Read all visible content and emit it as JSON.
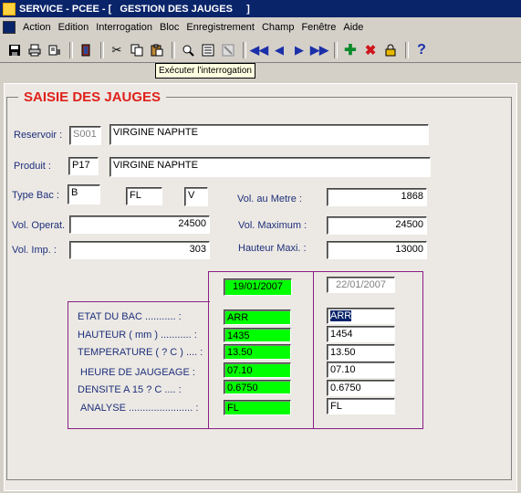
{
  "window": {
    "title": "SERVICE - PCEE - [   GESTION DES JAUGES     ]"
  },
  "menu": [
    "Action",
    "Edition",
    "Interrogation",
    "Bloc",
    "Enregistrement",
    "Champ",
    "Fenêtre",
    "Aide"
  ],
  "tooltip": "Exécuter l'interrogation",
  "group_title": "SAISIE DES JAUGES",
  "fields": {
    "reservoir": {
      "label": "Reservoir  :",
      "code": "S001",
      "name": "VIRGINE NAPHTE"
    },
    "produit": {
      "label": "Produit   :",
      "code": "P17",
      "name": "VIRGINE NAPHTE"
    },
    "type_bac": {
      "label": "Type Bac :",
      "v1": "B",
      "v2": "FL",
      "v3": "V"
    },
    "vol_metre": {
      "label": "Vol. au Metre    :",
      "value": "1868"
    },
    "vol_operat": {
      "label": "Vol. Operat.",
      "value": "24500"
    },
    "vol_maximum": {
      "label": "Vol. Maximum    :",
      "value": "24500"
    },
    "vol_imp": {
      "label": "Vol. Imp.   :",
      "value": "303"
    },
    "hauteur_maxi": {
      "label": "Hauteur Maxi.   :",
      "value": "13000"
    }
  },
  "measures": {
    "date1": "19/01/2007",
    "date2": "22/01/2007",
    "rows": [
      {
        "label": "ETAT  DU  BAC ........... :",
        "v1": "ARR",
        "v2": "ARR"
      },
      {
        "label": "HAUTEUR  ( mm ) ........... :",
        "v1": "1435",
        "v2": "1454"
      },
      {
        "label": "TEMPERATURE  ( ? C ) .... :",
        "v1": "13.50",
        "v2": "13.50"
      },
      {
        "label": "HEURE  DE  JAUGEAGE  :",
        "v1": "07.10",
        "v2": "07.10"
      },
      {
        "label": "DENSITE  A  15 ? C  .... :",
        "v1": "0.6750",
        "v2": "0.6750"
      },
      {
        "label": "ANALYSE  .......................  :",
        "v1": "FL",
        "v2": "FL"
      }
    ]
  },
  "colors": {
    "title_bg": "#0a246a",
    "group_title": "#e0201b",
    "label": "#1e2f7a",
    "green": "#00ff00",
    "frame": "#8b1e86"
  },
  "toolbar_icons": [
    "save-icon",
    "print-icon",
    "print-setup-icon",
    "exit-icon",
    "cut-icon",
    "copy-icon",
    "paste-icon",
    "enter-query-icon",
    "execute-query-icon",
    "cancel-query-icon",
    "first-record-icon",
    "previous-record-icon",
    "next-record-icon",
    "last-record-icon",
    "insert-record-icon",
    "delete-record-icon",
    "lock-record-icon",
    "help-icon"
  ]
}
